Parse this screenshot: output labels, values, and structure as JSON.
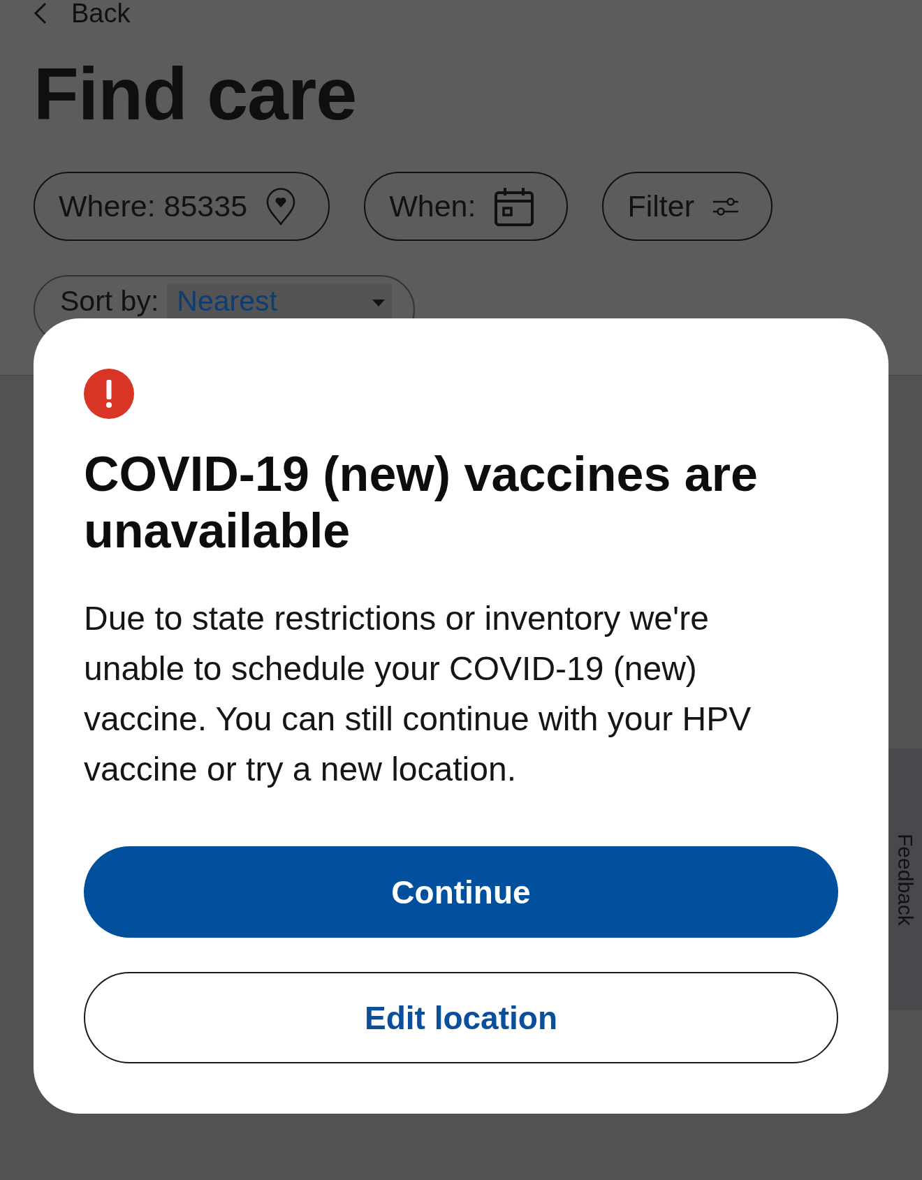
{
  "back_link": {
    "label": "Back"
  },
  "page_title": "Find care",
  "filters": [
    {
      "kind": "location",
      "label": "Where: 85335"
    },
    {
      "kind": "date",
      "label": "When:"
    },
    {
      "kind": "filter",
      "label": "Filter"
    }
  ],
  "sort": {
    "label": "Sort by:",
    "value": "Nearest"
  },
  "feedback_tab": {
    "label": "Feedback"
  },
  "dialog": {
    "title": "COVID-19 (new) vaccines are unavailable",
    "message": "Due to state restrictions or inventory we're unable to schedule your COVID-19 (new) vaccine. You can still continue with your HPV vaccine or try a new location.",
    "buttons": [
      {
        "kind": "primary",
        "label": "Continue"
      },
      {
        "kind": "secondary",
        "label": "Edit location"
      }
    ]
  }
}
